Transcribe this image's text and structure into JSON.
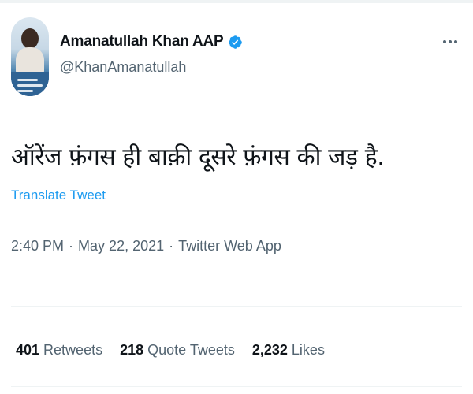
{
  "user": {
    "display_name": "Amanatullah Khan AAP",
    "handle": "@KhanAmanatullah",
    "verified": true
  },
  "tweet": {
    "text": "ऑरेंज फ़ंगस ही बाक़ी दूसरे फ़ंगस की जड़ है.",
    "translate_label": "Translate Tweet",
    "time": "2:40 PM",
    "date": "May 22, 2021",
    "source": "Twitter Web App",
    "separator": "·"
  },
  "stats": {
    "retweets_count": "401",
    "retweets_label": "Retweets",
    "quotes_count": "218",
    "quotes_label": "Quote Tweets",
    "likes_count": "2,232",
    "likes_label": "Likes"
  },
  "colors": {
    "accent": "#1d9bf0",
    "secondary_text": "#536471",
    "primary_text": "#0f1419",
    "divider": "#eff3f4"
  },
  "icons": {
    "verified": "verified-badge-icon",
    "more": "more-options-icon"
  }
}
